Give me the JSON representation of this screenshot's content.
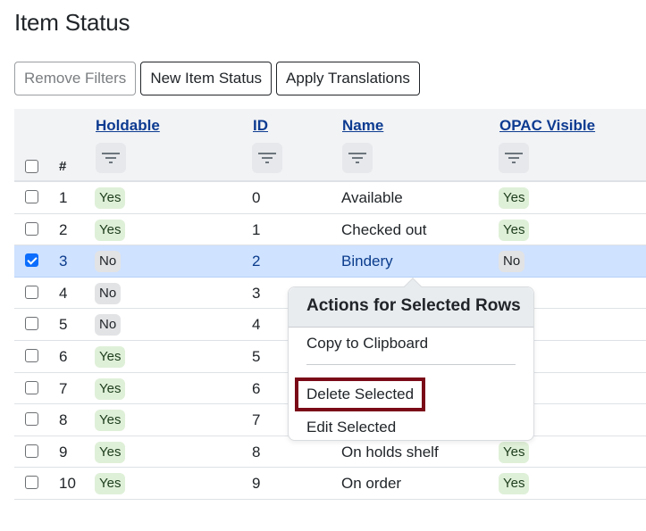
{
  "page": {
    "title": "Item Status"
  },
  "toolbar": {
    "remove_filters": "Remove Filters",
    "new_item_status": "New Item Status",
    "apply_translations": "Apply Translations"
  },
  "table": {
    "headers": {
      "row_number": "#",
      "holdable": "Holdable",
      "id": "ID",
      "name": "Name",
      "opac_visible": "OPAC Visible"
    },
    "rows": [
      {
        "num": "1",
        "holdable": "Yes",
        "id": "0",
        "name": "Available",
        "opac": "Yes",
        "selected": false
      },
      {
        "num": "2",
        "holdable": "Yes",
        "id": "1",
        "name": "Checked out",
        "opac": "Yes",
        "selected": false
      },
      {
        "num": "3",
        "holdable": "No",
        "id": "2",
        "name": "Bindery",
        "opac": "No",
        "selected": true
      },
      {
        "num": "4",
        "holdable": "No",
        "id": "3",
        "name": "",
        "opac": "",
        "selected": false
      },
      {
        "num": "5",
        "holdable": "No",
        "id": "4",
        "name": "",
        "opac": "",
        "selected": false
      },
      {
        "num": "6",
        "holdable": "Yes",
        "id": "5",
        "name": "",
        "opac": "",
        "selected": false
      },
      {
        "num": "7",
        "holdable": "Yes",
        "id": "6",
        "name": "",
        "opac": "",
        "selected": false
      },
      {
        "num": "8",
        "holdable": "Yes",
        "id": "7",
        "name": "",
        "opac": "",
        "selected": false
      },
      {
        "num": "9",
        "holdable": "Yes",
        "id": "8",
        "name": "On holds shelf",
        "opac": "Yes",
        "selected": false
      },
      {
        "num": "10",
        "holdable": "Yes",
        "id": "9",
        "name": "On order",
        "opac": "Yes",
        "selected": false
      }
    ]
  },
  "actions_popover": {
    "title": "Actions for Selected Rows",
    "items": [
      "Copy to Clipboard",
      "Delete Selected",
      "Edit Selected"
    ]
  },
  "colors": {
    "link": "#0d3b91",
    "selected_row": "#cfe2ff",
    "yes_badge": "#dff0d8",
    "no_badge": "#e2e3e5",
    "highlight": "#7a0a17"
  }
}
